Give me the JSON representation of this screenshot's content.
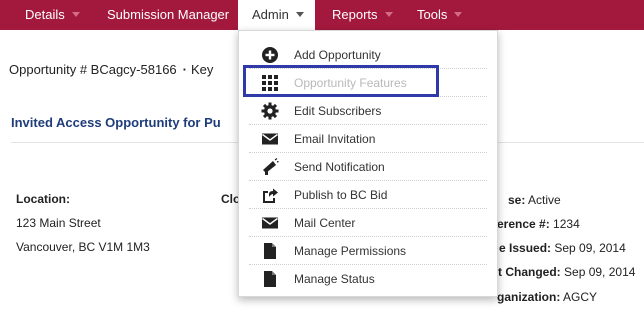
{
  "nav": {
    "items": [
      {
        "label": "Details"
      },
      {
        "label": "Submission Manager"
      },
      {
        "label": "Admin"
      },
      {
        "label": "Reports"
      },
      {
        "label": "Tools"
      }
    ]
  },
  "header": {
    "opportunity_line": "Opportunity # BCagcy-58166",
    "separator": "·",
    "key_label": "Key"
  },
  "section": {
    "title": "Invited Access Opportunity for Pu"
  },
  "details": {
    "location_label": "Location:",
    "address_line1": "123 Main Street",
    "address_line2": "Vancouver, BC V1M 1M3",
    "partial_label": "Clo",
    "status_label": "se:",
    "status_value": "Active",
    "reference_label": "erence #:",
    "reference_value": "1234",
    "issued_label": "e Issued:",
    "issued_value": "Sep 09, 2014",
    "changed_label": "t Changed:",
    "changed_value": "Sep 09, 2014",
    "org_label": "ganization:",
    "org_value": "AGCY"
  },
  "admin_menu": {
    "items": [
      {
        "label": "Add Opportunity",
        "icon": "plus-circle-icon"
      },
      {
        "label": "Opportunity Features",
        "icon": "grid-icon",
        "disabled": true,
        "highlighted": true
      },
      {
        "label": "Edit Subscribers",
        "icon": "gear-icon"
      },
      {
        "label": "Email Invitation",
        "icon": "envelope-icon"
      },
      {
        "label": "Send Notification",
        "icon": "megaphone-icon"
      },
      {
        "label": "Publish to BC Bid",
        "icon": "share-icon"
      },
      {
        "label": "Mail Center",
        "icon": "envelope-icon"
      },
      {
        "label": "Manage Permissions",
        "icon": "document-icon"
      },
      {
        "label": "Manage Status",
        "icon": "document-icon"
      }
    ]
  },
  "colors": {
    "nav_bg": "#a3193d",
    "title_blue": "#1f3d7a",
    "highlight_border": "#2f3aa8"
  }
}
